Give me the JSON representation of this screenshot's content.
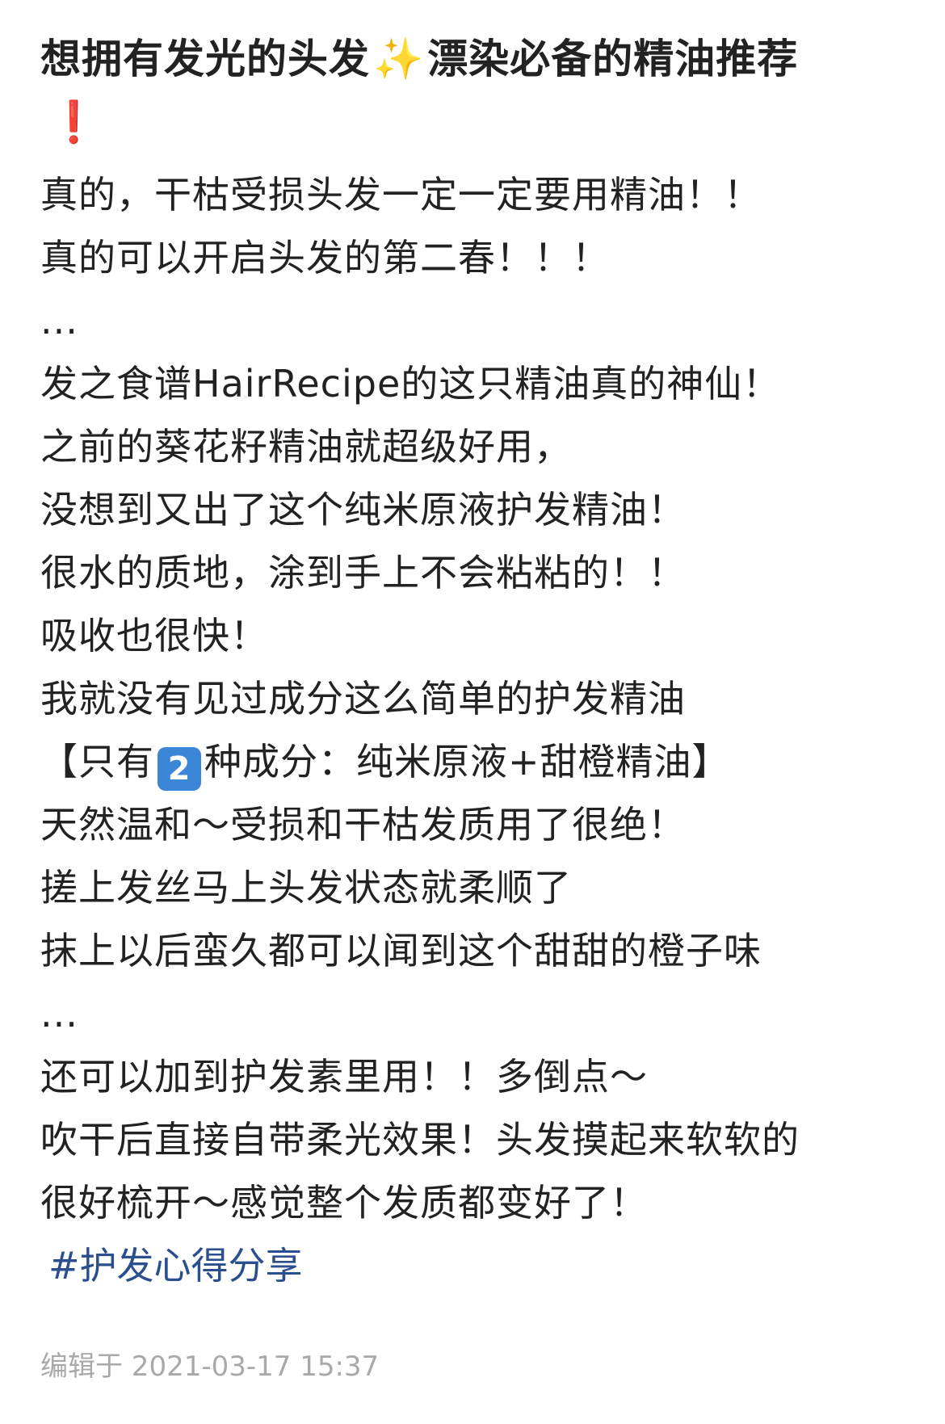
{
  "post": {
    "title_main": "想拥有发光的头发",
    "title_sparkles": "✨",
    "title_rest": "漂染必备的精油推荐",
    "title_exclaim": "❗",
    "lines": [
      "真的，干枯受损头发一定一定要用精油！！",
      "真的可以开启头发的第二春！！！",
      "...",
      "发之食谱HairRecipe的这只精油真的神仙！",
      "之前的葵花籽精油就超级好用，",
      "没想到又出了这个纯米原液护发精油！",
      "很水的质地，涂到手上不会粘粘的！！",
      "吸收也很快！"
    ],
    "lines_after_keycap_break": [
      "我就没有见过成分这么简单的护发精油"
    ],
    "keycap_line": {
      "prefix": "【只有",
      "keycap": "2",
      "suffix": "种成分：纯米原液+甜橙精油】"
    },
    "lines_2": [
      "天然温和～受损和干枯发质用了很绝！",
      "搓上发丝马上头发状态就柔顺了",
      "抹上以后蛮久都可以闻到这个甜甜的橙子味",
      "...",
      "还可以加到护发素里用！！多倒点～",
      "吹干后直接自带柔光效果！头发摸起来软软的",
      "很好梳开～感觉整个发质都变好了！"
    ],
    "hashtag": "#护发心得分享",
    "edited": "编辑于 2021-03-17 15:37"
  },
  "colors": {
    "text": "#222222",
    "hashtag": "#2b4e8f",
    "meta": "#a9a9a9",
    "keycap": "#3b86d6",
    "sparkles": "#f4c21b",
    "exclaim": "#e2172c"
  }
}
